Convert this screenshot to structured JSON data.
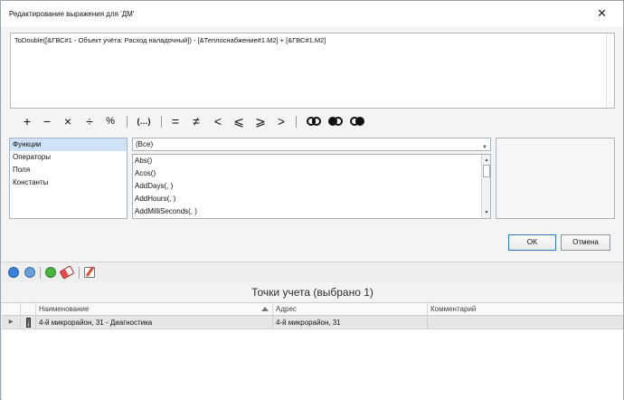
{
  "dialog": {
    "title": "Редактирование выражения для 'ДМ'",
    "close_label": "✕",
    "expression": "ToDouble([&ГВС#1 - Объект учёта: Расход наладочный]) - [&Теплоснабжение#1.M2] + [&ГВС#1.M2]",
    "operators": {
      "plus": "+",
      "minus": "−",
      "multiply": "×",
      "divide": "÷",
      "percent": "%",
      "parens": "(…)",
      "equal": "=",
      "not_equal": "≠",
      "less": "<",
      "less_equal": "⩽",
      "greater_equal": "⩾",
      "greater": ">"
    },
    "categories": [
      "Функции",
      "Операторы",
      "Поля",
      "Константы"
    ],
    "selected_category": "Функции",
    "filter_value": "(Все)",
    "functions": [
      "Abs()",
      "Acos()",
      "AddDays(, )",
      "AddHours(, )",
      "AddMilliSeconds(, )"
    ],
    "ok_label": "OK",
    "cancel_label": "Отмена"
  },
  "toolbar": {
    "icons": [
      "add-icon",
      "remove-icon",
      "check-icon",
      "eraser-icon",
      "edit-icon"
    ]
  },
  "grid": {
    "caption": "Точки учета (выбрано 1)",
    "columns": [
      "Наименование",
      "Адрес",
      "Комментарий"
    ],
    "rows": [
      {
        "name": "4-й микрорайон, 31 - Диагностика",
        "address": "4-й микрорайон, 31",
        "comment": ""
      }
    ],
    "row_indicator": "▶"
  }
}
